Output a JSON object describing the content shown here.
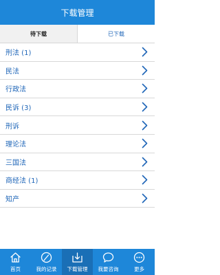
{
  "header": {
    "title": "下载管理"
  },
  "tabs": [
    {
      "label": "待下载",
      "active": true
    },
    {
      "label": "已下载",
      "active": false
    }
  ],
  "list": [
    {
      "label": "刑法 (1)"
    },
    {
      "label": "民法"
    },
    {
      "label": "行政法"
    },
    {
      "label": "民诉 (3)"
    },
    {
      "label": "刑诉"
    },
    {
      "label": "理论法"
    },
    {
      "label": "三国法"
    },
    {
      "label": "商经法 (1)"
    },
    {
      "label": "知产"
    }
  ],
  "tabbar": [
    {
      "label": "首页",
      "icon": "home-icon"
    },
    {
      "label": "我的记录",
      "icon": "pencil-icon"
    },
    {
      "label": "下载管理",
      "icon": "download-icon",
      "active": true
    },
    {
      "label": "我要咨询",
      "icon": "chat-bubble-icon"
    },
    {
      "label": "更多",
      "icon": "more-icon"
    }
  ],
  "colors": {
    "primary": "#1e87d9",
    "text": "#1f66b8",
    "active_tab_bg": "#f1f1f1"
  }
}
